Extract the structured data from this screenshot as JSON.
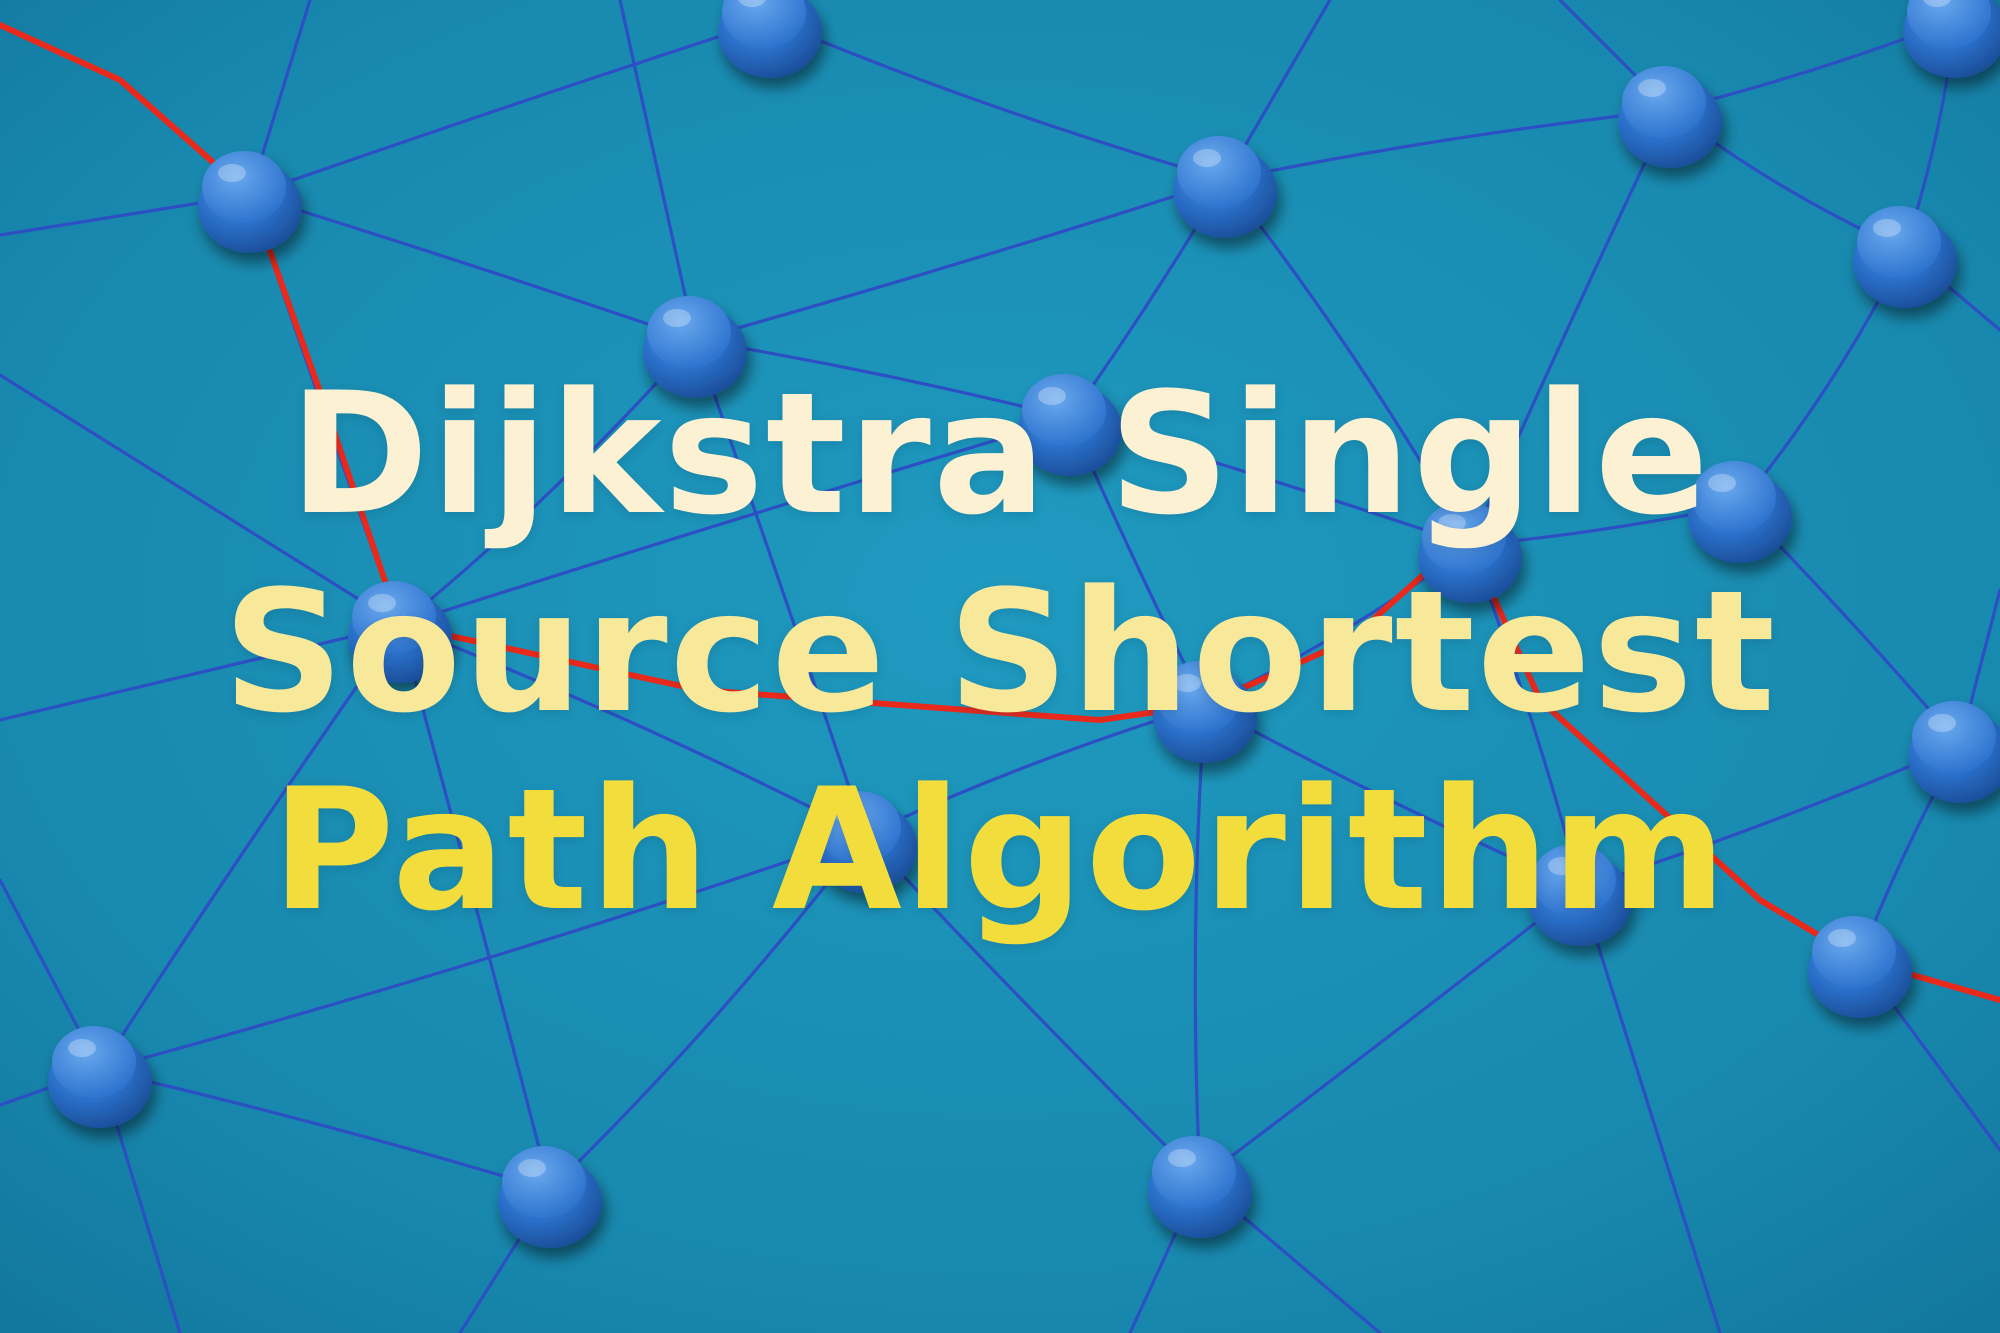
{
  "image": {
    "description_tag": "thumbnail",
    "colors": {
      "background": "#1a8db3",
      "string": "#2d4fc4",
      "highlight_string": "#e8291b",
      "pin": "#2a6fc9",
      "title_top": "#fdf4d8",
      "title_bottom": "#f3dd3c"
    },
    "title_lines": [
      "Dijkstra Single",
      "Source Shortest",
      "Path Algorithm"
    ]
  }
}
